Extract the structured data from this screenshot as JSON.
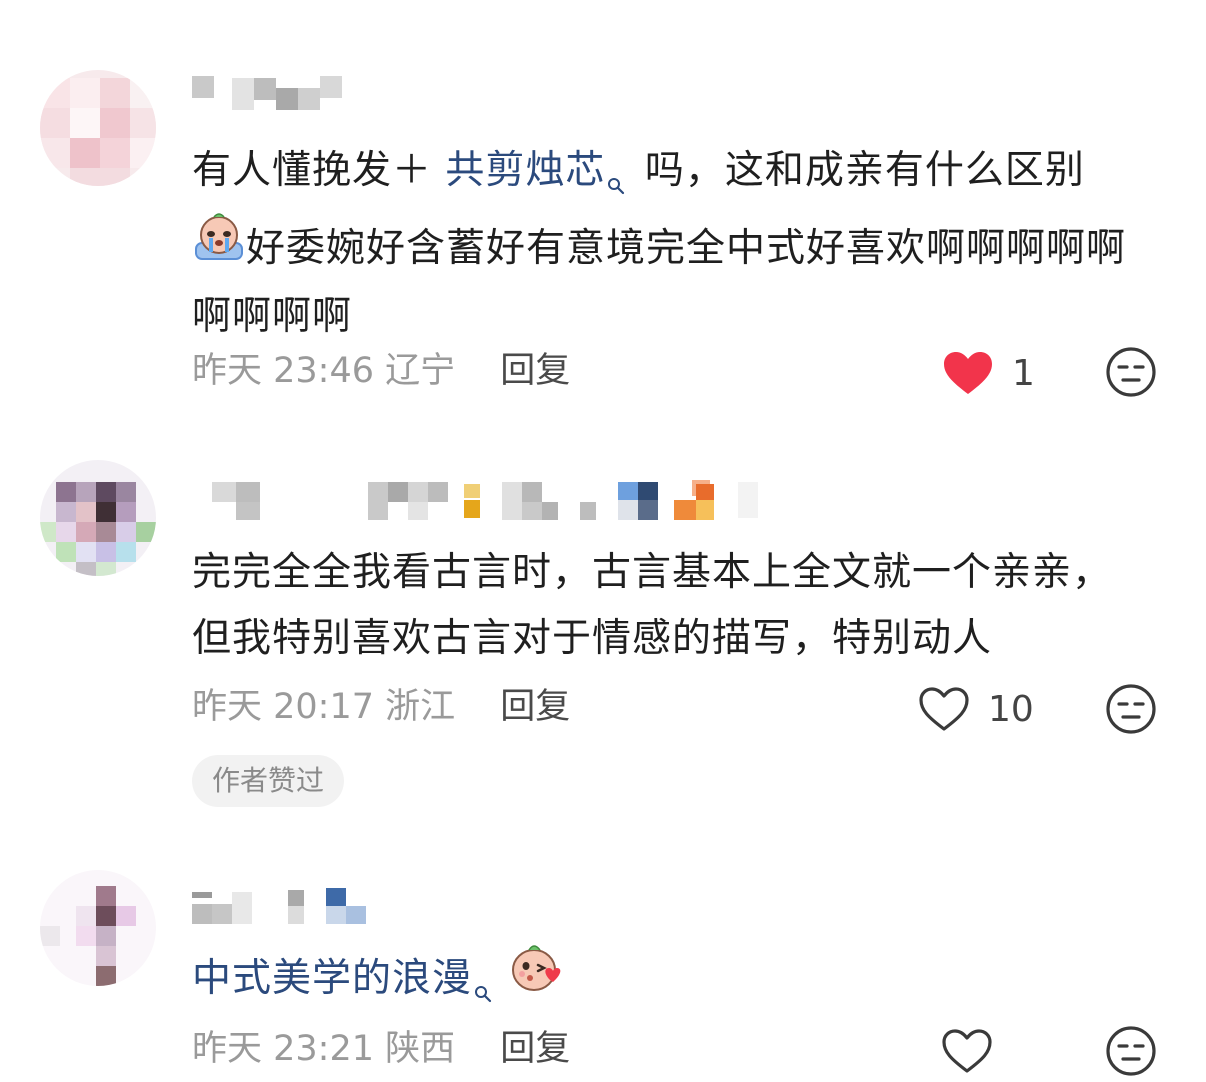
{
  "comments": [
    {
      "text_before": "有人懂挽发＋ ",
      "topic": "共剪烛芯",
      "text_after": " 吗，这和成亲有什么区别",
      "text_line2": "好委婉好含蓄好有意境完全中式好喜欢啊啊啊啊啊啊啊啊啊",
      "time": "昨天 23:46",
      "location": "辽宁",
      "reply_label": "回复",
      "likes": "1",
      "liked": true
    },
    {
      "text": "完完全全我看古言时，古言基本上全文就一个亲亲，但我特别喜欢古言对于情感的描写，特别动人",
      "time": "昨天 20:17",
      "location": "浙江",
      "reply_label": "回复",
      "likes": "10",
      "liked": false,
      "badge": "作者赞过"
    },
    {
      "topic": "中式美学的浪漫",
      "time": "昨天 23:21",
      "location": "陕西",
      "reply_label": "回复",
      "likes": "",
      "liked": false
    }
  ],
  "colors": {
    "topic": "#2b4a7d",
    "like_active": "#f2344b",
    "meta": "#9a9a9a"
  },
  "icons": {
    "search": "search-icon",
    "heart": "heart-icon",
    "dislike": "dislike-face-icon",
    "emoji_crying": "crying-emoji-icon",
    "emoji_kiss": "kiss-emoji-icon"
  }
}
